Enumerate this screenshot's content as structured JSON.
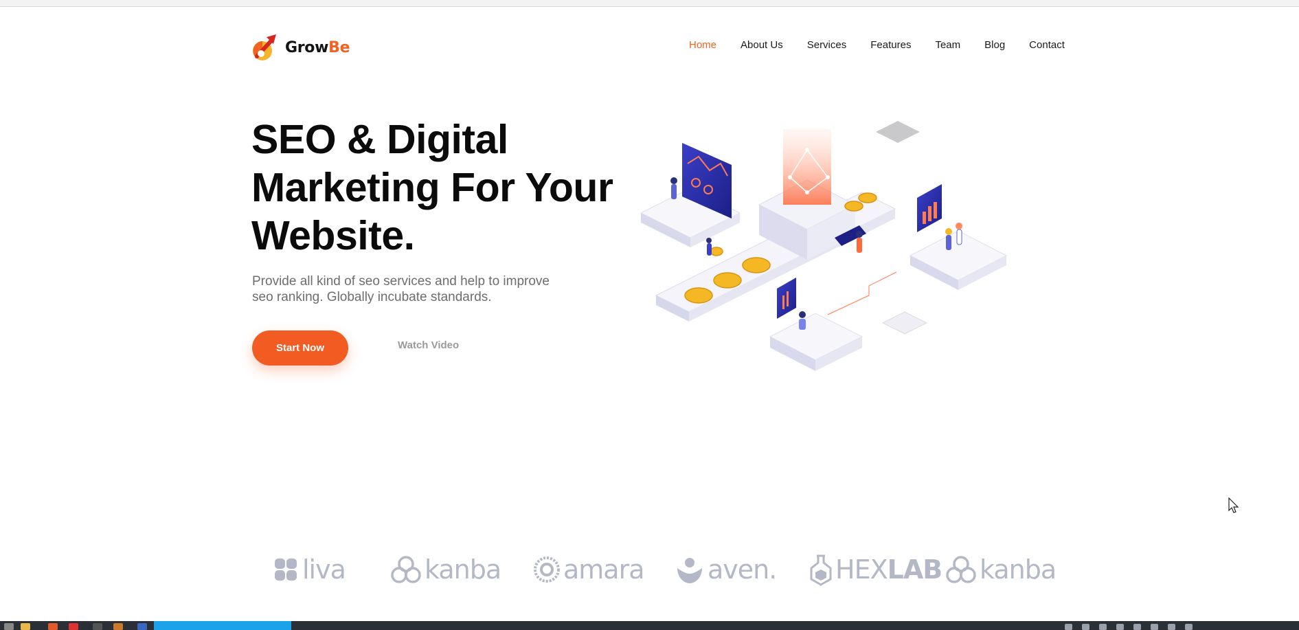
{
  "brand": {
    "name_part1": "Grow",
    "name_part2": "Be",
    "icon": "rocket-arrow-logo-icon"
  },
  "nav": {
    "items": [
      {
        "label": "Home",
        "active": true
      },
      {
        "label": "About Us"
      },
      {
        "label": "Services"
      },
      {
        "label": "Features"
      },
      {
        "label": "Team"
      },
      {
        "label": "Blog"
      },
      {
        "label": "Contact"
      }
    ]
  },
  "hero": {
    "title_line1": "SEO & Digital",
    "title_line2": "Marketing For Your",
    "title_line3": "Website.",
    "subtitle_line1": "Provide all kind of seo services and help to improve",
    "subtitle_line2": "seo ranking. Globally incubate standards.",
    "primary_button": "Start Now",
    "secondary_button": "Watch Video",
    "illustration": "isometric-seo-dashboard-illustration"
  },
  "partners": [
    {
      "name": "liva",
      "icon": "liva-logo-icon"
    },
    {
      "name": "kanba",
      "icon": "kanba-logo-icon"
    },
    {
      "name": "amara",
      "icon": "amara-logo-icon"
    },
    {
      "name": "aven.",
      "icon": "aven-logo-icon"
    },
    {
      "name_part1": "HEX",
      "name_part2": "LAB",
      "icon": "hexlab-logo-icon"
    },
    {
      "name": "kanba",
      "icon": "kanba-logo-icon"
    }
  ],
  "colors": {
    "accent": "#f26322",
    "button": "#f25b22",
    "heading": "#0b0b0b",
    "muted": "#6d6d6d",
    "partner_logo": "#b4b8c6"
  }
}
